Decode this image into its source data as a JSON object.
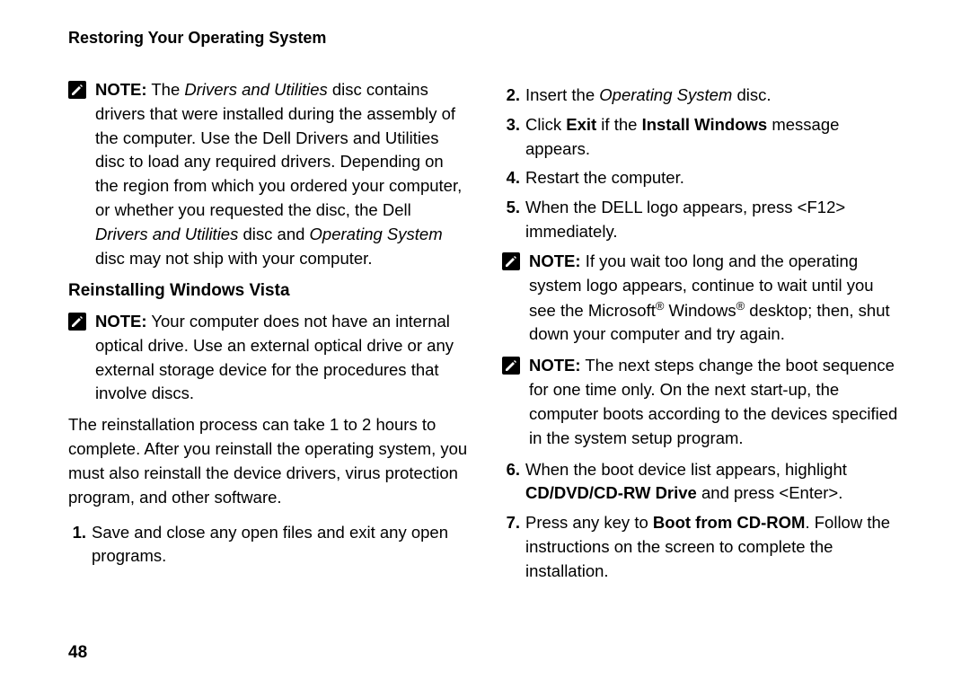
{
  "header": "Restoring Your Operating System",
  "page_number": "48",
  "left": {
    "note1": {
      "label": "NOTE:",
      "t1": " The ",
      "i1": "Drivers and Utilities",
      "t2": " disc contains drivers that were installed during the assembly of the computer. Use the Dell Drivers and Utilities disc to load any required drivers. Depending on the region from which you ordered your computer, or whether you requested the disc, the Dell ",
      "i2": "Drivers and Utilities",
      "t3": " disc and ",
      "i3": "Operating System",
      "t4": " disc may not ship with your computer."
    },
    "subhead": "Reinstalling Windows Vista",
    "note2": {
      "label": "NOTE:",
      "text": " Your computer does not have an internal optical drive. Use an external optical drive or any external storage device for the procedures that involve discs."
    },
    "para": "The reinstallation process can take 1 to 2 hours to complete. After you reinstall the operating system, you must also reinstall the device drivers, virus protection program, and other software.",
    "step1_num": "1.",
    "step1": "Save and close any open files and exit any open programs."
  },
  "right": {
    "step2_num": "2.",
    "step2_a": "Insert the ",
    "step2_i": "Operating System",
    "step2_b": " disc.",
    "step3_num": "3.",
    "step3_a": "Click ",
    "step3_b1": "Exit",
    "step3_c": " if the ",
    "step3_b2": "Install Windows",
    "step3_d": " message appears.",
    "step4_num": "4.",
    "step4": "Restart the computer.",
    "step5_num": "5.",
    "step5": "When the DELL logo appears, press <F12> immediately.",
    "note3": {
      "label": "NOTE:",
      "t1": " If you wait too long and the operating system logo appears, continue to wait until you see the Microsoft",
      "r": "®",
      "t2": " Windows",
      "t3": " desktop; then, shut down your computer and try again."
    },
    "note4": {
      "label": "NOTE:",
      "text": " The next steps change the boot sequence for one time only. On the next start-up, the computer boots according to the devices specified in the system setup program."
    },
    "step6_num": "6.",
    "step6_a": "When the boot device list appears, highlight ",
    "step6_b": "CD/DVD/CD-RW Drive",
    "step6_c": " and press <Enter>.",
    "step7_num": "7.",
    "step7_a": "Press any key to ",
    "step7_b": "Boot from CD-ROM",
    "step7_c": ". Follow the instructions on the screen to complete the installation."
  }
}
